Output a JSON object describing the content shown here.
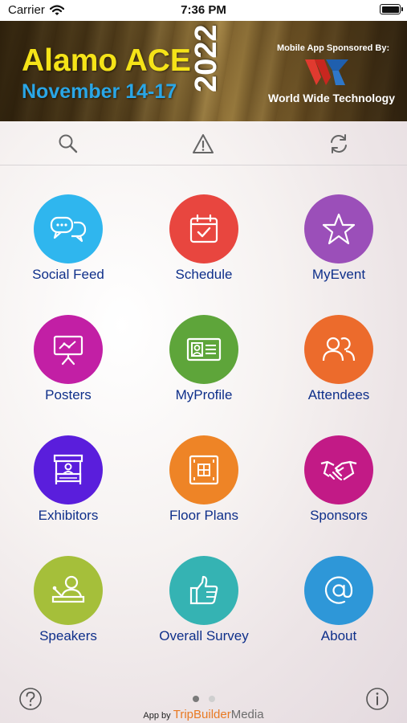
{
  "status_bar": {
    "carrier": "Carrier",
    "time": "7:36 PM",
    "icons": [
      "wifi-icon",
      "battery-icon"
    ]
  },
  "banner": {
    "title": "Alamo ACE",
    "dates": "November 14-17",
    "year": "2022",
    "sponsor_caption": "Mobile App Sponsored By:",
    "sponsor_name": "World Wide Technology",
    "colors": {
      "title": "#f5e318",
      "dates": "#2aa6e6"
    }
  },
  "toolbar": {
    "icons": [
      "search-icon",
      "warning-icon",
      "refresh-icon"
    ]
  },
  "menu": {
    "items": [
      {
        "label": "Social Feed",
        "icon": "chat-bubbles-icon",
        "color": "#2fb6ee"
      },
      {
        "label": "Schedule",
        "icon": "calendar-check-icon",
        "color": "#e8463f"
      },
      {
        "label": "MyEvent",
        "icon": "star-icon",
        "color": "#9b4fb9"
      },
      {
        "label": "Posters",
        "icon": "presentation-board-icon",
        "color": "#c21fa5"
      },
      {
        "label": "MyProfile",
        "icon": "id-card-icon",
        "color": "#5ea53a"
      },
      {
        "label": "Attendees",
        "icon": "people-icon",
        "color": "#ec6b2c"
      },
      {
        "label": "Exhibitors",
        "icon": "exhibit-booth-icon",
        "color": "#5a1edc"
      },
      {
        "label": "Floor Plans",
        "icon": "floor-plan-icon",
        "color": "#ee8426"
      },
      {
        "label": "Sponsors",
        "icon": "handshake-icon",
        "color": "#c21a86"
      },
      {
        "label": "Speakers",
        "icon": "speaker-podium-icon",
        "color": "#a5bf3a"
      },
      {
        "label": "Overall Survey",
        "icon": "thumbs-up-icon",
        "color": "#35b3b3"
      },
      {
        "label": "About",
        "icon": "at-sign-icon",
        "color": "#2e97d8"
      }
    ]
  },
  "footer": {
    "help_icon": "question-icon",
    "info_icon": "info-icon",
    "page_indicator": {
      "current": 1,
      "total": 2
    },
    "credit_prefix": "App by",
    "credit_brand_a": "TripBuilder",
    "credit_brand_b": "Media"
  }
}
